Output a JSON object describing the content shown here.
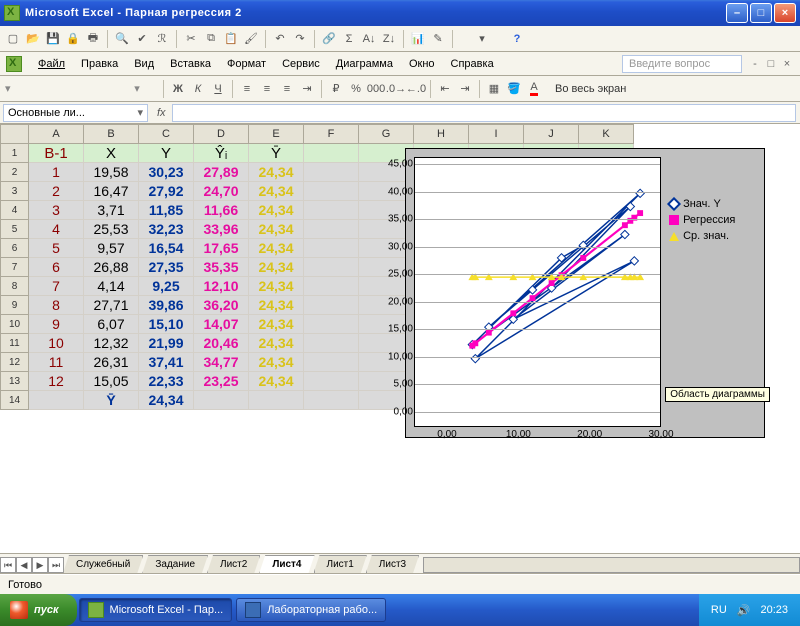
{
  "window": {
    "title": "Microsoft Excel - Парная регрессия 2"
  },
  "menu": {
    "file": "Файл",
    "edit": "Правка",
    "view": "Вид",
    "insert": "Вставка",
    "format": "Формат",
    "tools": "Сервис",
    "chart": "Диаграмма",
    "window": "Окно",
    "help": "Справка",
    "askbox": "Введите вопрос",
    "fullscreen": "Во весь экран"
  },
  "namebox": "Основные ли...",
  "columns": [
    "A",
    "B",
    "C",
    "D",
    "E",
    "F",
    "G",
    "H",
    "I",
    "J",
    "K"
  ],
  "headers": {
    "a": "B-1",
    "b": "X",
    "c": "Y",
    "d": "Ŷᵢ",
    "e": "Ȳ"
  },
  "rows": [
    {
      "n": "1",
      "a": "1",
      "b": "19,58",
      "c": "30,23",
      "d": "27,89",
      "e": "24,34"
    },
    {
      "n": "2",
      "a": "2",
      "b": "16,47",
      "c": "27,92",
      "d": "24,70",
      "e": "24,34"
    },
    {
      "n": "3",
      "a": "3",
      "b": "3,71",
      "c": "11,85",
      "d": "11,66",
      "e": "24,34"
    },
    {
      "n": "4",
      "a": "4",
      "b": "25,53",
      "c": "32,23",
      "d": "33,96",
      "e": "24,34"
    },
    {
      "n": "5",
      "a": "5",
      "b": "9,57",
      "c": "16,54",
      "d": "17,65",
      "e": "24,34"
    },
    {
      "n": "6",
      "a": "6",
      "b": "26,88",
      "c": "27,35",
      "d": "35,35",
      "e": "24,34"
    },
    {
      "n": "7",
      "a": "7",
      "b": "4,14",
      "c": "9,25",
      "d": "12,10",
      "e": "24,34"
    },
    {
      "n": "8",
      "a": "8",
      "b": "27,71",
      "c": "39,86",
      "d": "36,20",
      "e": "24,34"
    },
    {
      "n": "9",
      "a": "9",
      "b": "6,07",
      "c": "15,10",
      "d": "14,07",
      "e": "24,34"
    },
    {
      "n": "10",
      "a": "10",
      "b": "12,32",
      "c": "21,99",
      "d": "20,46",
      "e": "24,34"
    },
    {
      "n": "11",
      "a": "11",
      "b": "26,31",
      "c": "37,41",
      "d": "34,77",
      "e": "24,34"
    },
    {
      "n": "12",
      "a": "12",
      "b": "15,05",
      "c": "22,33",
      "d": "23,25",
      "e": "24,34"
    }
  ],
  "summary": {
    "label": "Ȳ",
    "value": "24,34",
    "row": "14"
  },
  "tabs": [
    "Служебный",
    "Задание",
    "Лист2",
    "Лист4",
    "Лист1",
    "Лист3"
  ],
  "active_tab": "Лист4",
  "status": "Готово",
  "taskbar": {
    "start": "пуск",
    "tasks": [
      {
        "label": "Microsoft Excel - Пар..."
      },
      {
        "label": "Лабораторная рабо..."
      }
    ],
    "lang": "RU",
    "time": "20:23"
  },
  "chart_tooltip": "Область диаграммы",
  "chart_data": {
    "type": "line",
    "xlabel": "",
    "ylabel": "",
    "xticks": [
      "0,00",
      "10,00",
      "20,00",
      "30,00"
    ],
    "yticks": [
      "0,00",
      "5,00",
      "10,00",
      "15,00",
      "20,00",
      "25,00",
      "30,00",
      "35,00",
      "40,00",
      "45,00"
    ],
    "xlim": [
      0,
      30
    ],
    "ylim": [
      0,
      45
    ],
    "x": [
      19.58,
      16.47,
      3.71,
      25.53,
      9.57,
      26.88,
      4.14,
      27.71,
      6.07,
      12.32,
      26.31,
      15.05
    ],
    "series": [
      {
        "name": "Знач. Y",
        "color": "#003399",
        "values": [
          30.23,
          27.92,
          11.85,
          32.23,
          16.54,
          27.35,
          9.25,
          39.86,
          15.1,
          21.99,
          37.41,
          22.33
        ]
      },
      {
        "name": "Регрессия",
        "color": "#ff00bf",
        "values": [
          27.89,
          24.7,
          11.66,
          33.96,
          17.65,
          35.35,
          12.1,
          36.2,
          14.07,
          20.46,
          34.77,
          23.25
        ]
      },
      {
        "name": "Ср. знач.",
        "color": "#f6df2a",
        "values": [
          24.34,
          24.34,
          24.34,
          24.34,
          24.34,
          24.34,
          24.34,
          24.34,
          24.34,
          24.34,
          24.34,
          24.34
        ]
      }
    ]
  }
}
